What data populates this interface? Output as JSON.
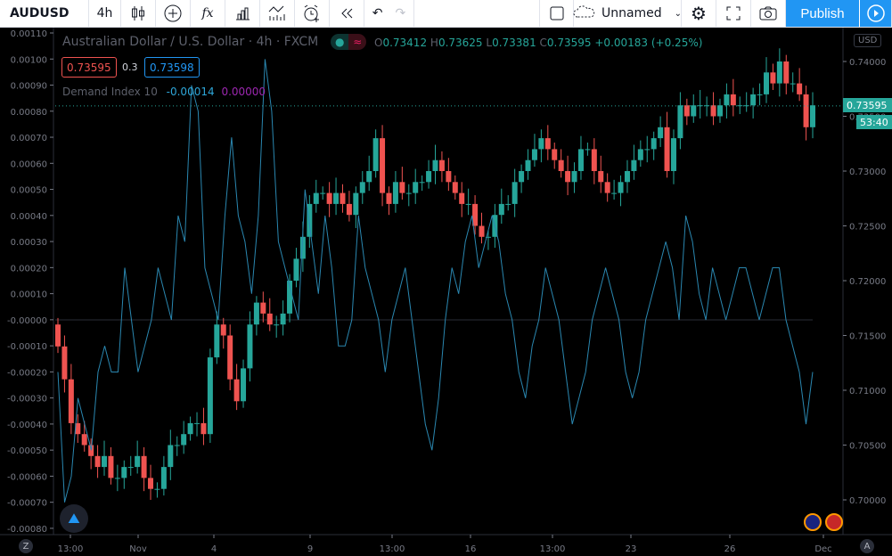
{
  "toolbar": {
    "symbol": "AUDUSD",
    "interval": "4h",
    "layout_name": "Unnamed",
    "publish": "Publish"
  },
  "header": {
    "title": "Australian Dollar / U.S. Dollar · 4h · FXCM",
    "o_label": "O",
    "o": "0.73412",
    "h_label": "H",
    "h": "0.73625",
    "l_label": "L",
    "l": "0.73381",
    "c_label": "C",
    "c": "0.73595",
    "change": "+0.00183 (+0.25%)",
    "sell": "0.73595",
    "spread": "0.3",
    "buy": "0.73598"
  },
  "indicator": {
    "name": "Demand Index 10",
    "value": "-0.00014",
    "value2": "0.00000"
  },
  "price_axis": {
    "currency": "USD",
    "labels": [
      "0.74000",
      "0.73500",
      "0.73000",
      "0.72500",
      "0.72000",
      "0.71500",
      "0.71000",
      "0.70500",
      "0.70000"
    ],
    "last_price": "0.73595",
    "countdown": "53:40"
  },
  "indicator_axis": {
    "labels": [
      "0.00110",
      "0.00100",
      "0.00090",
      "0.00080",
      "0.00070",
      "0.00060",
      "0.00050",
      "0.00040",
      "0.00030",
      "0.00020",
      "0.00010",
      "-0.00000",
      "-0.00010",
      "-0.00020",
      "-0.00030",
      "-0.00040",
      "-0.00050",
      "-0.00060",
      "-0.00070",
      "-0.00080"
    ]
  },
  "time_axis": {
    "labels": [
      "13:00",
      "Nov",
      "4",
      "9",
      "13:00",
      "16",
      "13:00",
      "23",
      "26",
      "Dec"
    ]
  },
  "buttons": {
    "z": "Z",
    "a": "A"
  },
  "colors": {
    "up": "#26a69a",
    "down": "#ef5350",
    "line": "#2a87b0",
    "accent": "#2196f3"
  },
  "chart_data": {
    "type": "candlestick",
    "closes": [
      0.714,
      0.711,
      0.707,
      0.706,
      0.705,
      0.704,
      0.703,
      0.704,
      0.702,
      0.702,
      0.703,
      0.703,
      0.704,
      0.702,
      0.701,
      0.701,
      0.703,
      0.705,
      0.705,
      0.706,
      0.707,
      0.707,
      0.706,
      0.713,
      0.716,
      0.715,
      0.711,
      0.709,
      0.712,
      0.716,
      0.718,
      0.717,
      0.716,
      0.716,
      0.717,
      0.72,
      0.722,
      0.724,
      0.727,
      0.728,
      0.728,
      0.727,
      0.728,
      0.727,
      0.726,
      0.728,
      0.729,
      0.73,
      0.733,
      0.728,
      0.727,
      0.729,
      0.728,
      0.728,
      0.729,
      0.729,
      0.73,
      0.731,
      0.73,
      0.729,
      0.728,
      0.727,
      0.727,
      0.725,
      0.724,
      0.724,
      0.726,
      0.727,
      0.727,
      0.729,
      0.73,
      0.731,
      0.732,
      0.733,
      0.732,
      0.731,
      0.73,
      0.729,
      0.73,
      0.732,
      0.732,
      0.73,
      0.729,
      0.728,
      0.728,
      0.729,
      0.73,
      0.731,
      0.732,
      0.732,
      0.733,
      0.734,
      0.73,
      0.733,
      0.736,
      0.735,
      0.736,
      0.736,
      0.736,
      0.735,
      0.736,
      0.737,
      0.736,
      0.736,
      0.736,
      0.737,
      0.737,
      0.739,
      0.738,
      0.74,
      0.738,
      0.738,
      0.737,
      0.734,
      0.736
    ],
    "demand_index": [
      -0.0002,
      -0.0007,
      -0.0006,
      -0.0003,
      -0.0004,
      -0.0005,
      -0.0002,
      -0.0001,
      -0.0002,
      -0.0002,
      0.0002,
      0.0,
      -0.0002,
      -0.0001,
      0.0,
      0.0002,
      0.0001,
      0.0,
      0.0004,
      0.0003,
      0.0009,
      0.0008,
      0.0002,
      0.0001,
      0.0,
      0.0004,
      0.0007,
      0.0004,
      0.0003,
      0.0001,
      0.0004,
      0.001,
      0.0008,
      0.0003,
      0.0002,
      0.0001,
      0.0,
      0.0005,
      0.0003,
      0.0001,
      0.0004,
      0.0002,
      -0.0001,
      -0.0001,
      0.0,
      0.0004,
      0.0002,
      0.0001,
      0.0,
      -0.0002,
      0.0,
      0.0001,
      0.0002,
      0.0,
      -0.0002,
      -0.0004,
      -0.0005,
      -0.0003,
      0.0,
      0.0002,
      0.0001,
      0.0003,
      0.0004,
      0.0002,
      0.0003,
      0.0004,
      0.0003,
      0.0001,
      0.0,
      -0.0002,
      -0.0003,
      -0.0001,
      0.0,
      0.0002,
      0.0001,
      0.0,
      -0.0002,
      -0.0004,
      -0.0003,
      -0.0002,
      0.0,
      0.0001,
      0.0002,
      0.0001,
      0.0,
      -0.0002,
      -0.0003,
      -0.0002,
      0.0,
      0.0001,
      0.0002,
      0.0003,
      0.0002,
      0.0,
      0.0004,
      0.0003,
      0.0001,
      0.0,
      0.0002,
      0.0001,
      0.0,
      0.0001,
      0.0002,
      0.0002,
      0.0001,
      0.0,
      0.0001,
      0.0002,
      0.0002,
      0.0,
      -0.0001,
      -0.0002,
      -0.0004,
      -0.0002
    ],
    "price_range": [
      0.6986,
      0.7418
    ],
    "indicator_range": [
      -0.00083,
      0.00112
    ]
  }
}
